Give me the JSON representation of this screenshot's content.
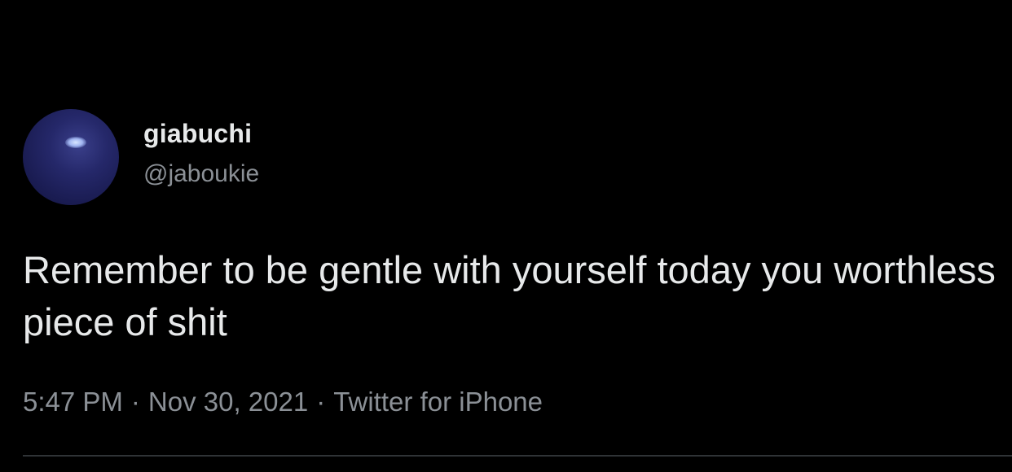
{
  "tweet": {
    "display_name": "giabuchi",
    "handle": "@jaboukie",
    "text": "Remember to be gentle with yourself today you worthless piece of shit",
    "time": "5:47 PM",
    "separator": "·",
    "date": "Nov 30, 2021",
    "source": "Twitter for iPhone"
  },
  "avatar": {
    "icon": "profile-avatar-icon"
  },
  "colors": {
    "background": "#000000",
    "primary_text": "#e7e9ea",
    "secondary_text": "#8b9096",
    "divider": "#2f3336",
    "avatar": "#1f2260"
  }
}
